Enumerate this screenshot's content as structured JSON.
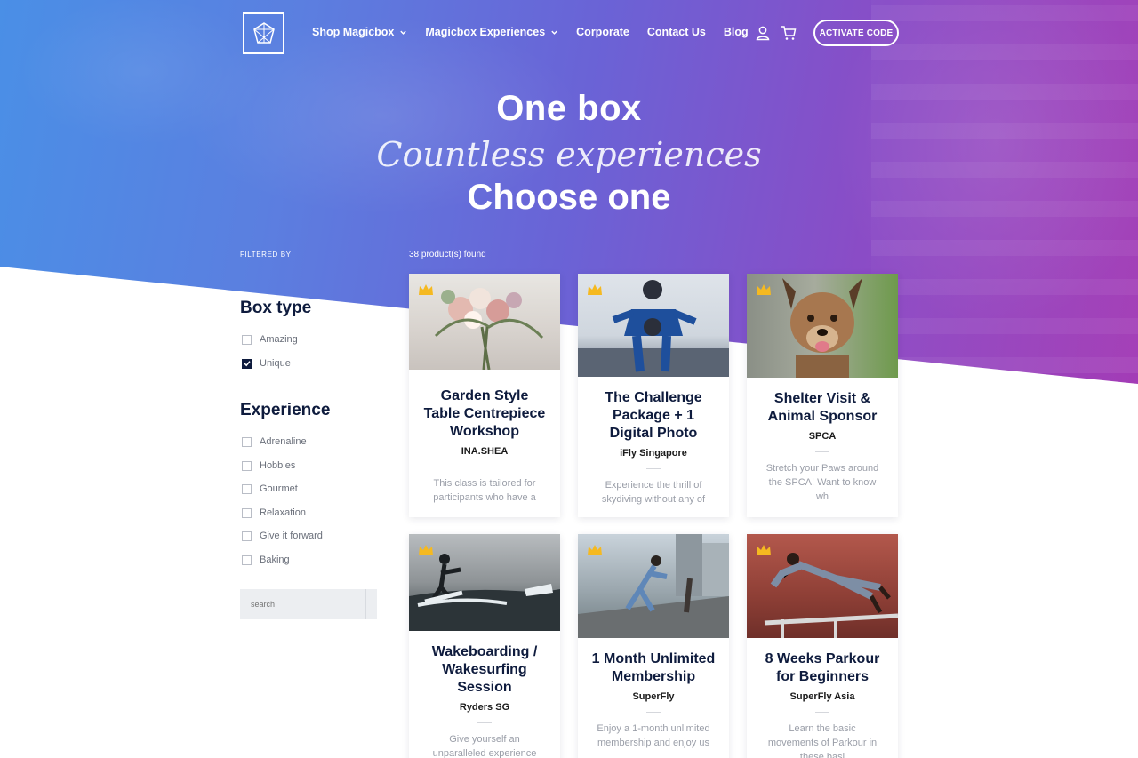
{
  "nav": {
    "items": [
      {
        "label": "Shop Magicbox",
        "dropdown": true
      },
      {
        "label": "Magicbox Experiences",
        "dropdown": true
      },
      {
        "label": "Corporate",
        "dropdown": false
      },
      {
        "label": "Contact Us",
        "dropdown": false
      },
      {
        "label": "Blog",
        "dropdown": false
      }
    ],
    "account_icon": "user-icon",
    "cart_icon": "cart-icon",
    "activate_label": "ACTIVATE CODE"
  },
  "hero": {
    "line1": "One box",
    "line2": "Countless experiences",
    "line3": "Choose one"
  },
  "filters": {
    "filtered_by": "FILTERED BY",
    "found": "38 product(s) found",
    "box_type": {
      "title": "Box type",
      "options": [
        {
          "label": "Amazing",
          "checked": false
        },
        {
          "label": "Unique",
          "checked": true
        }
      ]
    },
    "experience": {
      "title": "Experience",
      "options": [
        {
          "label": "Adrenaline",
          "checked": false
        },
        {
          "label": "Hobbies",
          "checked": false
        },
        {
          "label": "Gourmet",
          "checked": false
        },
        {
          "label": "Relaxation",
          "checked": false
        },
        {
          "label": "Give it forward",
          "checked": false
        },
        {
          "label": "Baking",
          "checked": false
        }
      ]
    },
    "search_placeholder": "search"
  },
  "products": [
    {
      "title": "Garden Style Table Centrepiece Workshop",
      "vendor": "INA.SHEA",
      "desc": "This class is tailored for participants who have a"
    },
    {
      "title": "The Challenge Package + 1 Digital Photo",
      "vendor": "iFly Singapore",
      "desc": "Experience the thrill of skydiving without any of"
    },
    {
      "title": "Shelter Visit & Animal Sponsor",
      "vendor": "SPCA",
      "desc": "Stretch your Paws around the SPCA! Want to know wh"
    },
    {
      "title": "Wakeboarding / Wakesurfing Session",
      "vendor": "Ryders SG",
      "desc": "Give yourself an unparalleled experience"
    },
    {
      "title": "1 Month Unlimited Membership",
      "vendor": "SuperFly",
      "desc": "Enjoy a 1-month unlimited membership and enjoy us"
    },
    {
      "title": "8 Weeks Parkour for Beginners",
      "vendor": "SuperFly Asia",
      "desc": "Learn the basic movements of Parkour in these basi"
    }
  ],
  "colors": {
    "navy": "#0e1b3d",
    "gradient_start": "#4a8fe6",
    "gradient_end": "#a33cb6",
    "crown": "#f5b920"
  }
}
